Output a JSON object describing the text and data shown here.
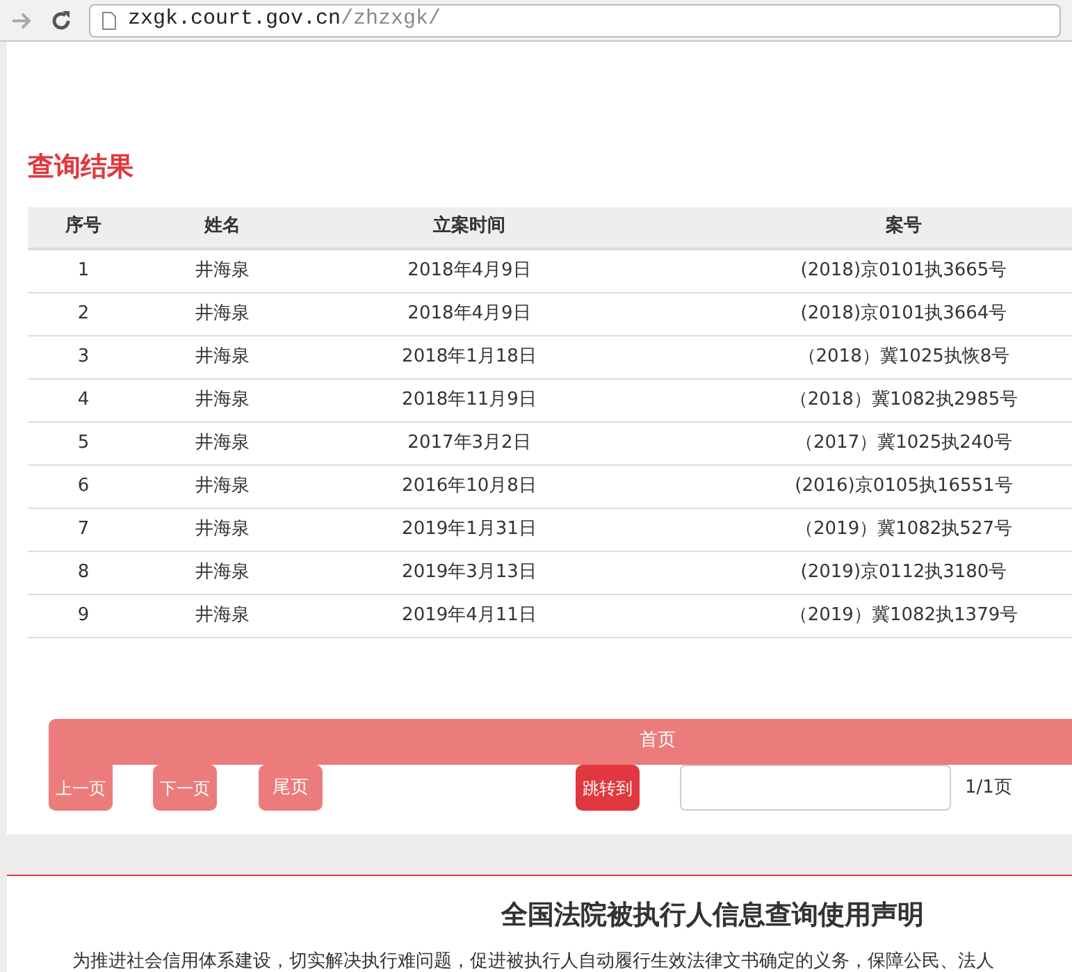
{
  "browser": {
    "url_host": "zxgk.court.gov.cn",
    "url_path": "/zhzxgk/"
  },
  "results": {
    "title": "查询结果",
    "table": {
      "columns": [
        "序号",
        "姓名",
        "立案时间",
        "案号"
      ],
      "rows": [
        [
          "1",
          "井海泉",
          "2018年4月9日",
          "(2018)京0101执3665号"
        ],
        [
          "2",
          "井海泉",
          "2018年4月9日",
          "(2018)京0101执3664号"
        ],
        [
          "3",
          "井海泉",
          "2018年1月18日",
          "（2018）冀1025执恢8号"
        ],
        [
          "4",
          "井海泉",
          "2018年11月9日",
          "（2018）冀1082执2985号"
        ],
        [
          "5",
          "井海泉",
          "2017年3月2日",
          "（2017）冀1025执240号"
        ],
        [
          "6",
          "井海泉",
          "2016年10月8日",
          "(2016)京0105执16551号"
        ],
        [
          "7",
          "井海泉",
          "2019年1月31日",
          "（2019）冀1082执527号"
        ],
        [
          "8",
          "井海泉",
          "2019年3月13日",
          "(2019)京0112执3180号"
        ],
        [
          "9",
          "井海泉",
          "2019年4月11日",
          "（2019）冀1082执1379号"
        ]
      ]
    }
  },
  "pagination": {
    "first": "首页",
    "prev": "上一页",
    "next": "下一页",
    "last": "尾页",
    "jump": "跳转到",
    "page_count": "1/1页"
  },
  "statement": {
    "title": "全国法院被执行人信息查询使用声明",
    "text": "为推进社会信用体系建设，切实解决执行难问题，促进被执行人自动履行生效法律文书确定的义务，保障公民、法人"
  }
}
